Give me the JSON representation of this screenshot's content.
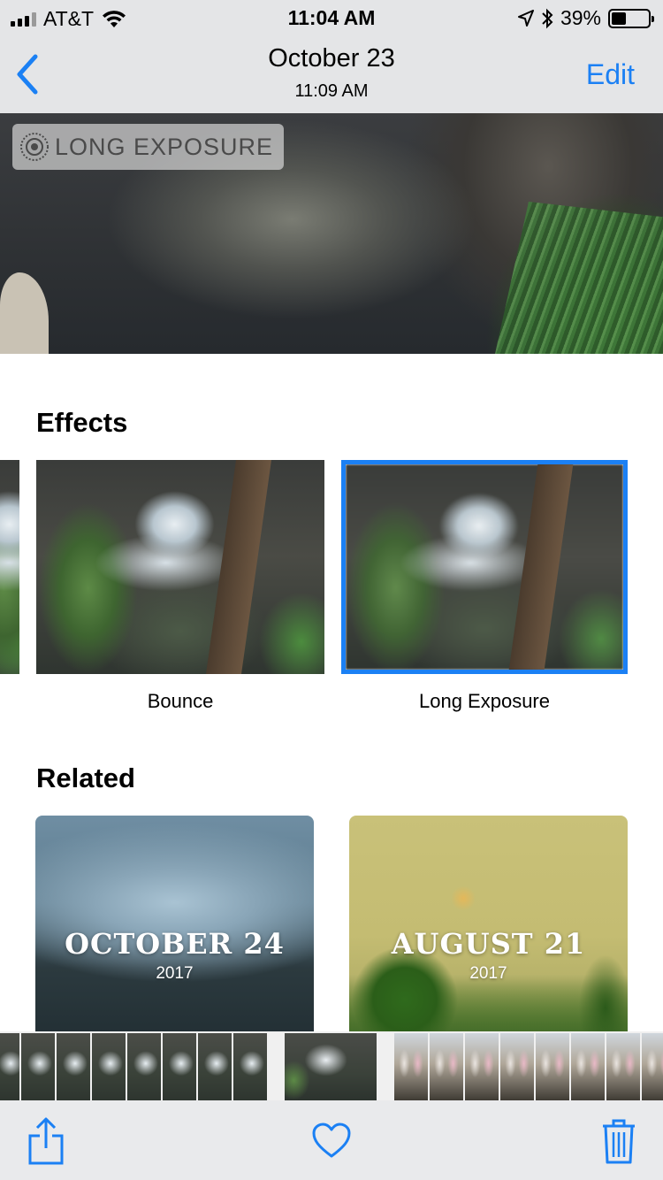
{
  "status_bar": {
    "carrier": "AT&T",
    "time": "11:04 AM",
    "battery": "39%",
    "battery_level": 0.39,
    "icons": [
      "signal-icon",
      "wifi-icon",
      "location-icon",
      "bluetooth-icon",
      "battery-icon"
    ]
  },
  "nav": {
    "title": "October 23",
    "subtitle": "11:09 AM",
    "edit_label": "Edit",
    "back_icon": "chevron-left-icon"
  },
  "hero": {
    "badge_label": "LONG EXPOSURE",
    "badge_icon": "live-photo-icon"
  },
  "effects": {
    "title": "Effects",
    "items": [
      {
        "label": "Bounce",
        "selected": false
      },
      {
        "label": "Long Exposure",
        "selected": true
      }
    ]
  },
  "related": {
    "title": "Related",
    "items": [
      {
        "title": "OCTOBER 24",
        "year": "2017"
      },
      {
        "title": "AUGUST 21",
        "year": "2017"
      }
    ]
  },
  "toolbar": {
    "share_icon": "share-icon",
    "like_icon": "heart-icon",
    "delete_icon": "trash-icon"
  },
  "colors": {
    "accent": "#1b80f4",
    "bar_background": "#e4e5e7"
  }
}
